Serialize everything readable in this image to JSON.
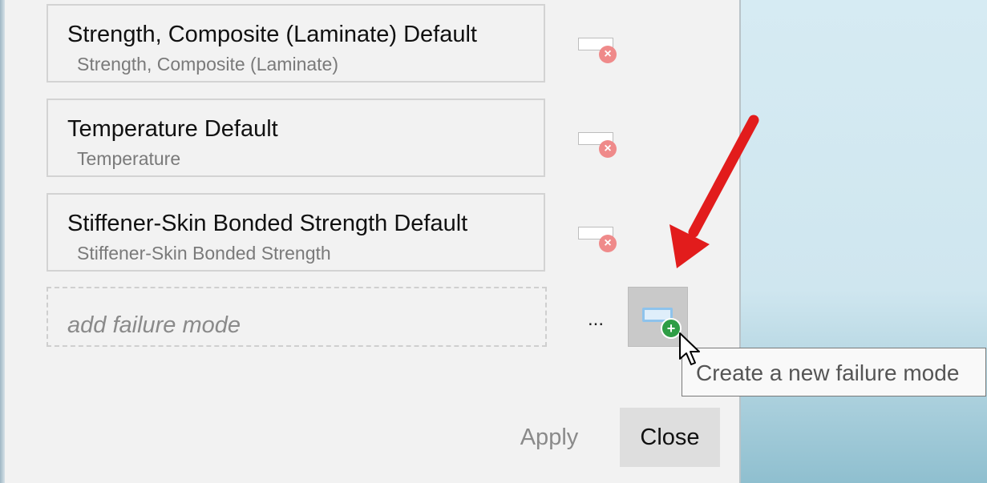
{
  "failure_modes": [
    {
      "title": "Strength, Composite (Laminate) Default",
      "subtitle": "Strength, Composite (Laminate)",
      "remove_icon": "remove-x-icon"
    },
    {
      "title": "Temperature Default",
      "subtitle": "Temperature",
      "remove_icon": "remove-x-icon"
    },
    {
      "title": "Stiffener-Skin Bonded Strength Default",
      "subtitle": "Stiffener-Skin Bonded Strength",
      "remove_icon": "remove-x-icon"
    }
  ],
  "add_failure_mode": {
    "placeholder": "add failure mode",
    "ellipsis_label": "...",
    "new_button_icon": "add-plus-icon",
    "tooltip": "Create a new failure mode"
  },
  "footer": {
    "apply_label": "Apply",
    "close_label": "Close"
  },
  "colors": {
    "annotation_arrow": "#e21c1c",
    "remove_badge": "#ef8a8a",
    "add_badge": "#2e9d45"
  }
}
